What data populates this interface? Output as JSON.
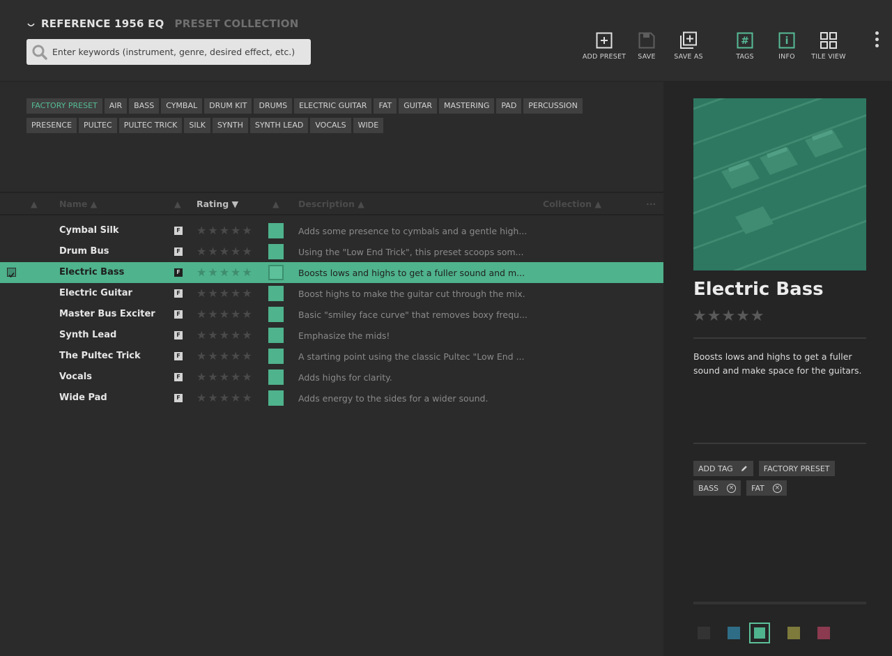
{
  "header": {
    "app_title": "REFERENCE 1956 EQ",
    "collection_title": "PRESET COLLECTION",
    "search_placeholder": "Enter keywords (instrument, genre, desired effect, etc.)",
    "toolbar": {
      "add_preset": "ADD PRESET",
      "save": "SAVE",
      "save_as": "SAVE AS",
      "tags": "TAGS",
      "info": "INFO",
      "tile_view": "TILE VIEW"
    }
  },
  "tags": [
    {
      "label": "FACTORY PRESET",
      "active": true
    },
    {
      "label": "AIR"
    },
    {
      "label": "BASS"
    },
    {
      "label": "CYMBAL"
    },
    {
      "label": "DRUM KIT"
    },
    {
      "label": "DRUMS"
    },
    {
      "label": "ELECTRIC GUITAR"
    },
    {
      "label": "FAT"
    },
    {
      "label": "GUITAR"
    },
    {
      "label": "MASTERING"
    },
    {
      "label": "PAD"
    },
    {
      "label": "PERCUSSION"
    },
    {
      "label": "PRESENCE"
    },
    {
      "label": "PULTEC"
    },
    {
      "label": "PULTEC TRICK"
    },
    {
      "label": "SILK"
    },
    {
      "label": "SYNTH"
    },
    {
      "label": "SYNTH LEAD"
    },
    {
      "label": "VOCALS"
    },
    {
      "label": "WIDE"
    }
  ],
  "table": {
    "columns": {
      "name": "Name ▲",
      "rating": "Rating ▼",
      "description": "Description ▲",
      "collection": "Collection ▲",
      "sort_arrow": "▲",
      "more": "···"
    },
    "rows": [
      {
        "name": "Cymbal Silk",
        "badge": "F",
        "stars": "★★★★★",
        "description": "Adds some presence to cymbals and a gentle high..."
      },
      {
        "name": "Drum Bus",
        "badge": "F",
        "stars": "★★★★★",
        "description": "Using the \"Low End Trick\", this preset scoops som..."
      },
      {
        "name": "Electric Bass",
        "badge": "F",
        "stars": "★★★★★",
        "description": "Boosts lows and highs to get a fuller sound and m...",
        "selected": true
      },
      {
        "name": "Electric Guitar",
        "badge": "F",
        "stars": "★★★★★",
        "description": "Boost highs to make the guitar cut through the mix."
      },
      {
        "name": "Master Bus Exciter",
        "badge": "F",
        "stars": "★★★★★",
        "description": "Basic \"smiley face curve\" that removes boxy frequ..."
      },
      {
        "name": "Synth Lead",
        "badge": "F",
        "stars": "★★★★★",
        "description": "Emphasize the mids!"
      },
      {
        "name": "The Pultec Trick",
        "badge": "F",
        "stars": "★★★★★",
        "description": "A starting point using the classic Pultec \"Low End ..."
      },
      {
        "name": "Vocals",
        "badge": "F",
        "stars": "★★★★★",
        "description": "Adds highs for clarity."
      },
      {
        "name": "Wide Pad",
        "badge": "F",
        "stars": "★★★★★",
        "description": "Adds energy to the sides for a wider sound."
      }
    ]
  },
  "detail": {
    "title": "Electric Bass",
    "stars": "★★★★★",
    "description": "Boosts lows and highs to get a fuller sound and make space for the guitars.",
    "add_tag": "ADD TAG",
    "tags": [
      "FACTORY PRESET",
      "BASS",
      "FAT"
    ],
    "remove_glyph": "×",
    "colors": [
      "#333333",
      "#2f6d86",
      "#4fb38d",
      "#7d7a3c",
      "#8b3a4f"
    ],
    "selected_color": "#4fb38d"
  }
}
